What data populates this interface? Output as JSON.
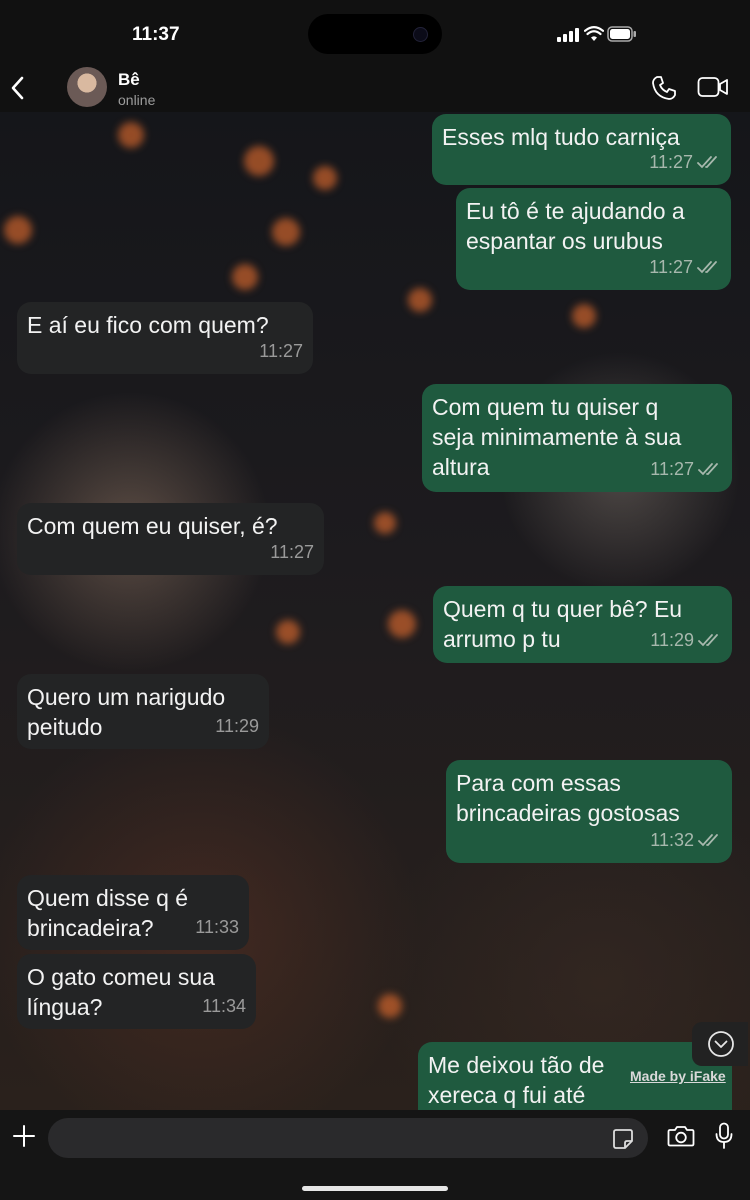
{
  "status_bar": {
    "time": "11:37"
  },
  "header": {
    "contact_name": "Bê",
    "presence": "online"
  },
  "messages": [
    {
      "text": "Esses mlq tudo carniça",
      "time": "11:27",
      "direction": "outgoing"
    },
    {
      "text": "Eu tô é te ajudando a\nespantar os urubus",
      "time": "11:27",
      "direction": "outgoing"
    },
    {
      "text": "E aí eu fico com quem?",
      "time": "11:27",
      "direction": "incoming"
    },
    {
      "text": "Com quem tu quiser q\nseja minimamente à sua\naltura",
      "time": "11:27",
      "direction": "outgoing"
    },
    {
      "text": "Com quem eu quiser, é?",
      "time": "11:27",
      "direction": "incoming"
    },
    {
      "text": "Quem q tu quer bê? Eu\narrumo p tu",
      "time": "11:29",
      "direction": "outgoing"
    },
    {
      "text": "Quero um narigudo\npeitudo",
      "time": "11:29",
      "direction": "incoming"
    },
    {
      "text": "Para com essas\nbrincadeiras gostosas",
      "time": "11:32",
      "direction": "outgoing"
    },
    {
      "text": "Quem disse q é\nbrincadeira?",
      "time": "11:33",
      "direction": "incoming"
    },
    {
      "text": "O gato comeu sua\nlíngua?",
      "time": "11:34",
      "direction": "incoming"
    },
    {
      "text": "Me deixou tão de\nxereca q fui até",
      "time": "",
      "direction": "outgoing"
    }
  ],
  "watermark": "Made by iFake",
  "colors": {
    "outgoing_bubble": "#1f5a3f",
    "incoming_bubble": "#232425",
    "read_ticks": "#a7b8ad"
  },
  "icons": [
    "back-chevron-icon",
    "phone-icon",
    "video-call-icon",
    "plus-icon",
    "sticker-icon",
    "camera-icon",
    "microphone-icon",
    "scroll-down-icon"
  ]
}
